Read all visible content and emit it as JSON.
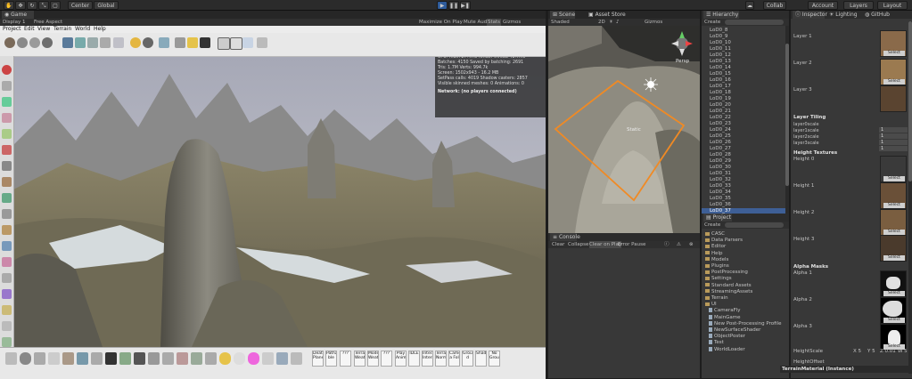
{
  "toolbar": {
    "pivot_label": "Center",
    "space_label": "Global",
    "collab_label": "Collab",
    "account_label": "Account",
    "layers_label": "Layers",
    "layout_label": "Layout"
  },
  "game": {
    "tab_label": "Game",
    "display_label": "Display 1",
    "aspect_label": "Free Aspect",
    "maximize_label": "Maximize On Play",
    "mute_label": "Mute Audio",
    "stats_label": "Stats",
    "gizmos_label": "Gizmos",
    "menu": [
      "Project",
      "Edit",
      "View",
      "Terrain",
      "World",
      "Help"
    ],
    "bottom_labels": [
      "Death Plane",
      "Patha ble",
      "???",
      "Terrain Weatha",
      "Model Weatha",
      "???",
      "Play Animal",
      "IDLE",
      "Interact Internal",
      "Terrain Normal",
      "Camer a Fol",
      "Ground d",
      "Shading",
      "No Ground"
    ]
  },
  "stats": {
    "audio_header": "Audio:",
    "audio_lines": [
      "Level: -74.8 dB      DSP load: 0.6%",
      "Clipping: 0.0%        Stream load: 0.0%"
    ],
    "graphics_header": "Graphics:",
    "fps": "23.4 FPS (42.7ms)",
    "graphics_lines": [
      "CPU: main 27.4ms  render thread 41.7ms",
      "Batches: 4150        Saved by batching: 2691",
      "Tris: 1.7M             Verts: 994.7k",
      "Screen: 1502x943 - 16.2 MB",
      "SetPass calls: 4019   Shadow casters: 2857",
      "Visible skinned meshes: 0   Animations: 0"
    ],
    "network": "Network: (no players connected)"
  },
  "scene": {
    "tab_label": "Scene",
    "tab2_label": "Asset Store",
    "shaded_label": "Shaded",
    "mode_label": "2D",
    "gizmos_label": "Gizmos",
    "static_label": "Static",
    "persp_label": "Persp"
  },
  "console": {
    "tab_label": "Console",
    "buttons": [
      "Clear",
      "Collapse",
      "Clear on Play",
      "Error Pause"
    ]
  },
  "hierarchy": {
    "tab_label": "Hierarchy",
    "create_label": "Create",
    "items": [
      "LoD0_8",
      "LoD0_9",
      "LoD0_10",
      "LoD0_11",
      "LoD0_12",
      "LoD0_13",
      "LoD0_14",
      "LoD0_15",
      "LoD0_16",
      "LoD0_17",
      "LoD0_18",
      "LoD0_19",
      "LoD0_20",
      "LoD0_21",
      "LoD0_22",
      "LoD0_23",
      "LoD0_24",
      "LoD0_25",
      "LoD0_26",
      "LoD0_27",
      "LoD0_28",
      "LoD0_29",
      "LoD0_30",
      "LoD0_31",
      "LoD0_32",
      "LoD0_33",
      "LoD0_34",
      "LoD0_35",
      "LoD0_36",
      "LoD0_37"
    ],
    "selected": "LoD0_37"
  },
  "project": {
    "tab_label": "Project",
    "create_label": "Create",
    "items": [
      {
        "label": "CASC",
        "type": "folder"
      },
      {
        "label": "Data Parsers",
        "type": "folder"
      },
      {
        "label": "Editor",
        "type": "folder"
      },
      {
        "label": "Help",
        "type": "folder"
      },
      {
        "label": "Models",
        "type": "folder"
      },
      {
        "label": "Plugins",
        "type": "folder"
      },
      {
        "label": "PostProcessing",
        "type": "folder"
      },
      {
        "label": "Settings",
        "type": "folder"
      },
      {
        "label": "Standard Assets",
        "type": "folder"
      },
      {
        "label": "StreamingAssets",
        "type": "folder"
      },
      {
        "label": "Terrain",
        "type": "folder"
      },
      {
        "label": "UI",
        "type": "folder"
      },
      {
        "label": "CameraFly",
        "type": "file"
      },
      {
        "label": "MainGame",
        "type": "file"
      },
      {
        "label": "New Post-Processing Profile",
        "type": "file"
      },
      {
        "label": "NewSurfaceShader",
        "type": "file"
      },
      {
        "label": "ObjectPoster",
        "type": "file"
      },
      {
        "label": "Test",
        "type": "file"
      },
      {
        "label": "WorldLoader",
        "type": "file"
      }
    ]
  },
  "inspector": {
    "tab_label": "Inspector",
    "lighting_label": "Lighting",
    "github_label": "GitHub",
    "layers": [
      "Layer 1",
      "Layer 2",
      "Layer 3"
    ],
    "tiling_header": "Layer Tiling",
    "tiling_rows": [
      {
        "label": "layer0scale",
        "value": "1"
      },
      {
        "label": "layer1scale",
        "value": "1"
      },
      {
        "label": "layer2scale",
        "value": "1"
      },
      {
        "label": "layer3scale",
        "value": "1"
      }
    ],
    "height_header": "Height Textures",
    "heights": [
      "Height 0",
      "Height 1",
      "Height 2",
      "Height 3"
    ],
    "alpha_header": "Alpha Masks",
    "alphas": [
      "Alpha 1",
      "Alpha 2",
      "Alpha 3"
    ],
    "heightscale_label": "HeightScale",
    "heightscale_values": [
      "X 5",
      "Y 5",
      "Z 0.01",
      "W 5"
    ],
    "heightoffset_label": "HeightOffset",
    "select_label": "Select",
    "footer": "TerrainMaterial (Instance)"
  }
}
